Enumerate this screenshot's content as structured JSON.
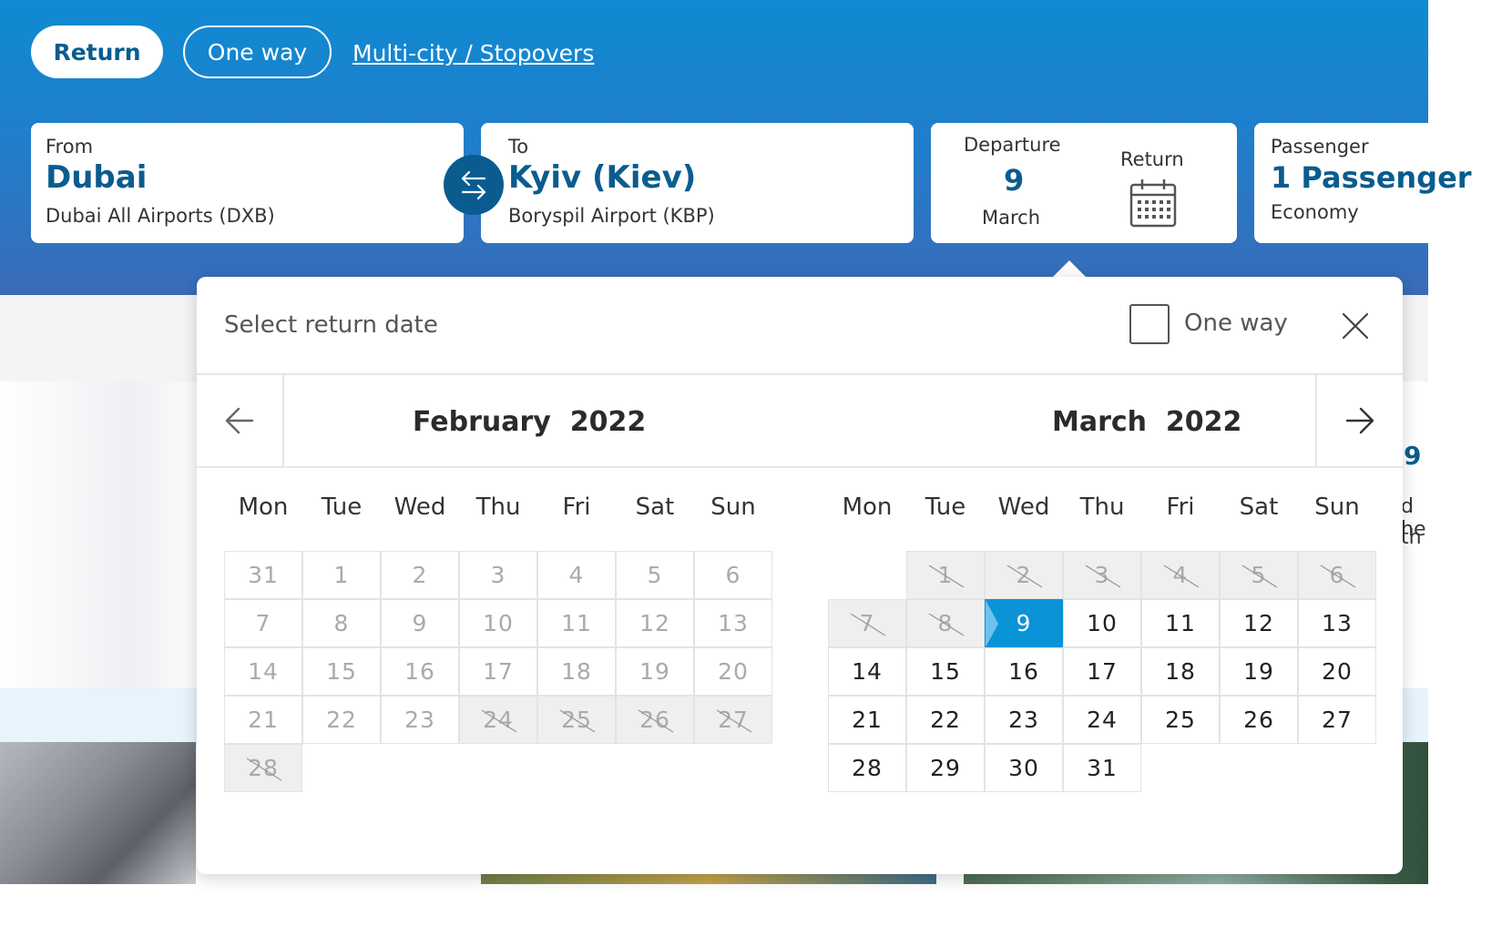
{
  "trip_types": {
    "return": "Return",
    "one_way": "One way",
    "multi_city": "Multi-city / Stopovers"
  },
  "from": {
    "label": "From",
    "city": "Dubai",
    "airport": "Dubai All Airports (DXB)"
  },
  "to": {
    "label": "To",
    "city": "Kyiv (Kiev)",
    "airport": "Boryspil Airport (KBP)"
  },
  "dates": {
    "departure_label": "Departure",
    "departure_day": "9",
    "departure_month": "March",
    "return_label": "Return"
  },
  "passenger": {
    "label": "Passenger",
    "value": "1 Passenger",
    "cabin": "Economy"
  },
  "icons": {
    "swap": "swap-arrows-icon",
    "calendar": "calendar-icon",
    "close": "close-icon",
    "prev": "arrow-left-icon",
    "next": "arrow-right-icon"
  },
  "colors": {
    "brand": "#0a5c8f",
    "selected": "#0a93d6",
    "hero_top": "#0f8ad2",
    "hero_bottom": "#3a6bb8"
  },
  "calendar": {
    "title": "Select return date",
    "one_way_label": "One way",
    "one_way_checked": false,
    "weekdays": [
      "Mon",
      "Tue",
      "Wed",
      "Thu",
      "Fri",
      "Sat",
      "Sun"
    ],
    "months": [
      {
        "name": "February  2022",
        "rows": [
          [
            {
              "d": "31",
              "s": "past"
            },
            {
              "d": "1",
              "s": "past"
            },
            {
              "d": "2",
              "s": "past"
            },
            {
              "d": "3",
              "s": "past"
            },
            {
              "d": "4",
              "s": "past"
            },
            {
              "d": "5",
              "s": "past"
            },
            {
              "d": "6",
              "s": "past"
            }
          ],
          [
            {
              "d": "7",
              "s": "past"
            },
            {
              "d": "8",
              "s": "past"
            },
            {
              "d": "9",
              "s": "past"
            },
            {
              "d": "10",
              "s": "past"
            },
            {
              "d": "11",
              "s": "past"
            },
            {
              "d": "12",
              "s": "past"
            },
            {
              "d": "13",
              "s": "past"
            }
          ],
          [
            {
              "d": "14",
              "s": "past"
            },
            {
              "d": "15",
              "s": "past"
            },
            {
              "d": "16",
              "s": "past"
            },
            {
              "d": "17",
              "s": "past"
            },
            {
              "d": "18",
              "s": "past"
            },
            {
              "d": "19",
              "s": "past"
            },
            {
              "d": "20",
              "s": "past"
            }
          ],
          [
            {
              "d": "21",
              "s": "past"
            },
            {
              "d": "22",
              "s": "past"
            },
            {
              "d": "23",
              "s": "past"
            },
            {
              "d": "24",
              "s": "blocked"
            },
            {
              "d": "25",
              "s": "blocked"
            },
            {
              "d": "26",
              "s": "blocked"
            },
            {
              "d": "27",
              "s": "blocked"
            }
          ],
          [
            {
              "d": "28",
              "s": "blocked"
            },
            null,
            null,
            null,
            null,
            null,
            null
          ]
        ]
      },
      {
        "name": "March  2022",
        "rows": [
          [
            null,
            {
              "d": "1",
              "s": "blocked"
            },
            {
              "d": "2",
              "s": "blocked"
            },
            {
              "d": "3",
              "s": "blocked"
            },
            {
              "d": "4",
              "s": "blocked"
            },
            {
              "d": "5",
              "s": "blocked"
            },
            {
              "d": "6",
              "s": "blocked"
            }
          ],
          [
            {
              "d": "7",
              "s": "blocked"
            },
            {
              "d": "8",
              "s": "blocked"
            },
            {
              "d": "9",
              "s": "selected"
            },
            {
              "d": "10",
              "s": "available"
            },
            {
              "d": "11",
              "s": "available"
            },
            {
              "d": "12",
              "s": "available"
            },
            {
              "d": "13",
              "s": "available"
            }
          ],
          [
            {
              "d": "14",
              "s": "available"
            },
            {
              "d": "15",
              "s": "available"
            },
            {
              "d": "16",
              "s": "available"
            },
            {
              "d": "17",
              "s": "available"
            },
            {
              "d": "18",
              "s": "available"
            },
            {
              "d": "19",
              "s": "available"
            },
            {
              "d": "20",
              "s": "available"
            }
          ],
          [
            {
              "d": "21",
              "s": "available"
            },
            {
              "d": "22",
              "s": "available"
            },
            {
              "d": "23",
              "s": "available"
            },
            {
              "d": "24",
              "s": "available"
            },
            {
              "d": "25",
              "s": "available"
            },
            {
              "d": "26",
              "s": "available"
            },
            {
              "d": "27",
              "s": "available"
            }
          ],
          [
            {
              "d": "28",
              "s": "available"
            },
            {
              "d": "29",
              "s": "available"
            },
            {
              "d": "30",
              "s": "available"
            },
            {
              "d": "31",
              "s": "available"
            },
            null,
            null,
            null
          ]
        ]
      }
    ]
  },
  "background_peek": {
    "number": "9",
    "line1": "d he",
    "line2": "th"
  }
}
